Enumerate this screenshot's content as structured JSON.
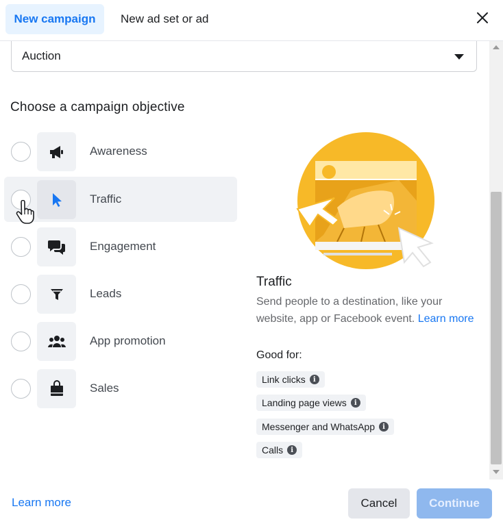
{
  "header": {
    "tabs": [
      {
        "label": "New campaign",
        "active": true
      },
      {
        "label": "New ad set or ad",
        "active": false
      }
    ],
    "close_icon": "close-icon"
  },
  "buying_type": {
    "value": "Auction"
  },
  "objectives_section": {
    "title": "Choose a campaign objective",
    "items": [
      {
        "label": "Awareness",
        "icon": "megaphone-icon",
        "selected": false,
        "hovered": false
      },
      {
        "label": "Traffic",
        "icon": "cursor-arrow-icon",
        "selected": false,
        "hovered": true
      },
      {
        "label": "Engagement",
        "icon": "chat-bubbles-icon",
        "selected": false,
        "hovered": false
      },
      {
        "label": "Leads",
        "icon": "funnel-icon",
        "selected": false,
        "hovered": false
      },
      {
        "label": "App promotion",
        "icon": "people-group-icon",
        "selected": false,
        "hovered": false
      },
      {
        "label": "Sales",
        "icon": "shopping-bag-icon",
        "selected": false,
        "hovered": false
      }
    ]
  },
  "detail": {
    "title": "Traffic",
    "description": "Send people to a destination, like your website, app or Facebook event.",
    "learn_more": "Learn more",
    "good_for_label": "Good for:",
    "good_for": [
      "Link clicks",
      "Landing page views",
      "Messenger and WhatsApp",
      "Calls"
    ]
  },
  "footer": {
    "learn_more": "Learn more",
    "cancel": "Cancel",
    "continue": "Continue"
  },
  "colors": {
    "accent": "#1877f2",
    "tab_active_bg": "#e7f3ff",
    "continue_disabled": "#8fb8ee",
    "illustration_yellow": "#f7b928"
  }
}
